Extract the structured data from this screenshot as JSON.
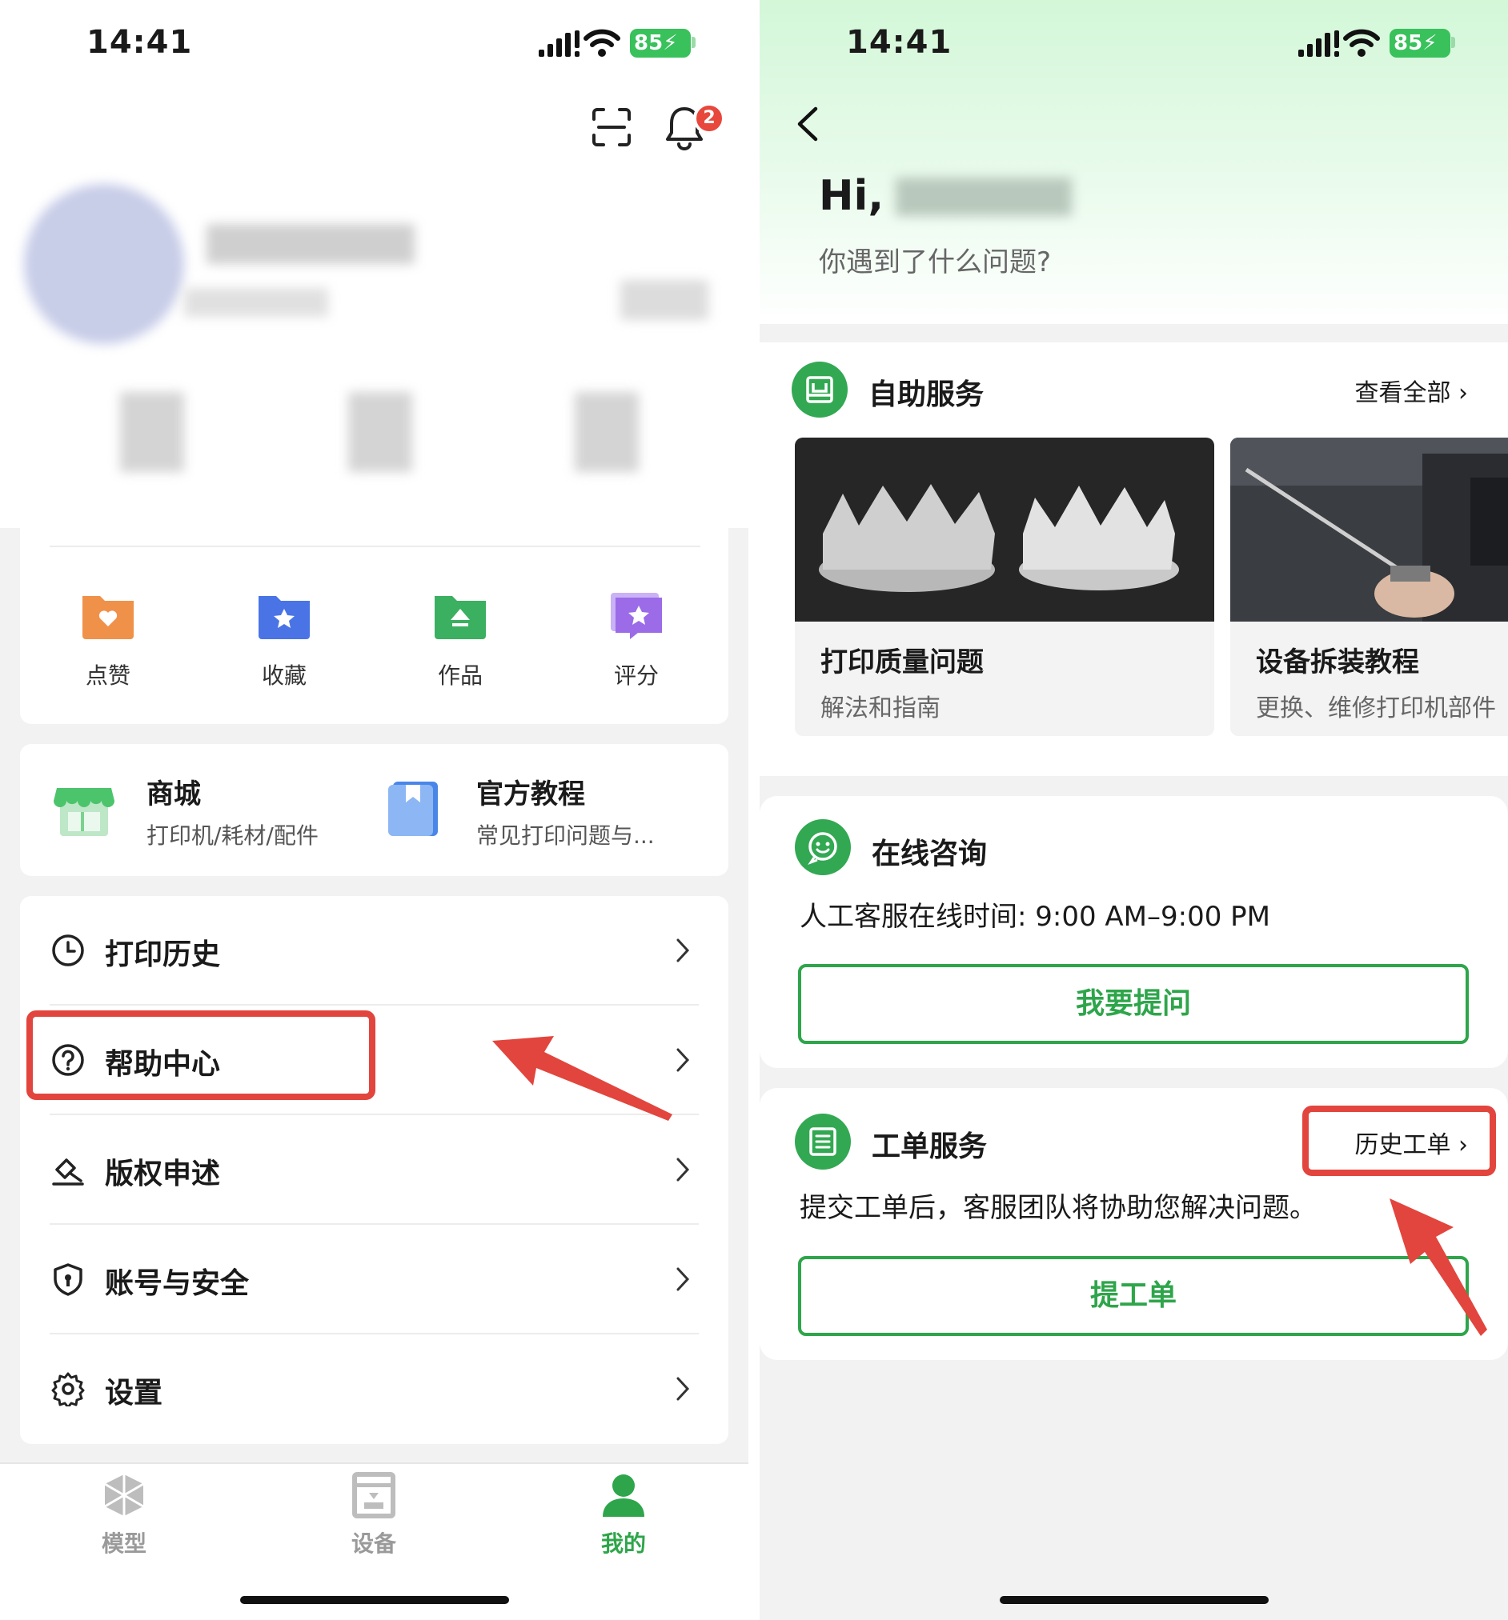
{
  "status_bar": {
    "time": "14:41",
    "battery": "85"
  },
  "left": {
    "notification_count": "2",
    "quick_actions": [
      {
        "label": "点赞",
        "color": "#f0914a"
      },
      {
        "label": "收藏",
        "color": "#4a74e6"
      },
      {
        "label": "作品",
        "color": "#3bb060"
      },
      {
        "label": "评分",
        "color": "#9b6be8"
      }
    ],
    "mall": {
      "title": "商城",
      "subtitle": "打印机/耗材/配件"
    },
    "tutorial": {
      "title": "官方教程",
      "subtitle": "常见打印问题与..."
    },
    "menu": [
      {
        "label": "打印历史",
        "icon": "clock-icon"
      },
      {
        "label": "帮助中心",
        "icon": "help-circle-icon"
      },
      {
        "label": "版权申述",
        "icon": "gavel-icon"
      },
      {
        "label": "账号与安全",
        "icon": "shield-icon"
      },
      {
        "label": "设置",
        "icon": "gear-icon"
      }
    ],
    "tabs": [
      {
        "label": "模型",
        "icon": "cube-icon",
        "active": false
      },
      {
        "label": "设备",
        "icon": "printer-icon",
        "active": false
      },
      {
        "label": "我的",
        "icon": "user-icon",
        "active": true
      }
    ],
    "accent": "#2ea54a",
    "highlight": "#e2453d"
  },
  "right": {
    "greeting": "Hi,",
    "question": "你遇到了什么问题?",
    "self_service": {
      "title": "自助服务",
      "see_all": "查看全部",
      "tiles": [
        {
          "title": "打印质量问题",
          "subtitle": "解法和指南"
        },
        {
          "title": "设备拆装教程",
          "subtitle": "更换、维修打印机部件"
        }
      ]
    },
    "consult": {
      "title": "在线咨询",
      "hours": "人工客服在线时间: 9:00 AM–9:00 PM",
      "button": "我要提问"
    },
    "ticket": {
      "title": "工单服务",
      "history": "历史工单",
      "desc": "提交工单后，客服团队将协助您解决问题。",
      "button": "提工单"
    }
  }
}
